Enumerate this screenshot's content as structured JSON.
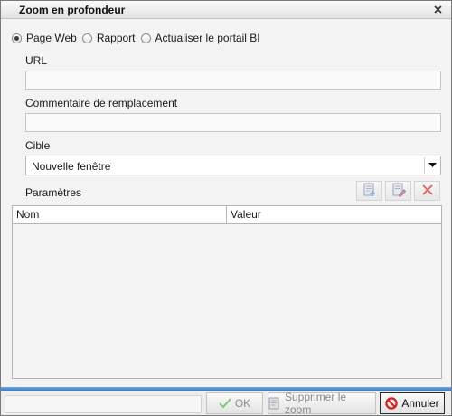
{
  "window": {
    "title": "Zoom en profondeur"
  },
  "target_type": {
    "options": [
      "Page Web",
      "Rapport",
      "Actualiser le portail BI"
    ],
    "selected": "Page Web"
  },
  "url": {
    "label": "URL",
    "value": ""
  },
  "alt_comment": {
    "label": "Commentaire de remplacement",
    "value": ""
  },
  "target": {
    "label": "Cible",
    "selected": "Nouvelle fenêtre"
  },
  "parameters": {
    "label": "Paramètres",
    "columns": [
      "Nom",
      "Valeur"
    ],
    "rows": [],
    "toolbar_icons": [
      "add-parameter-icon",
      "edit-parameter-icon",
      "delete-parameter-icon"
    ]
  },
  "footer": {
    "ok_label": "OK",
    "remove_label": "Supprimer le zoom",
    "cancel_label": "Annuler"
  },
  "colors": {
    "accent_bar": "#3a7cc8",
    "delete_red": "#e06060",
    "cancel_icon": "#d42020",
    "ok_check": "#5cb85c"
  }
}
